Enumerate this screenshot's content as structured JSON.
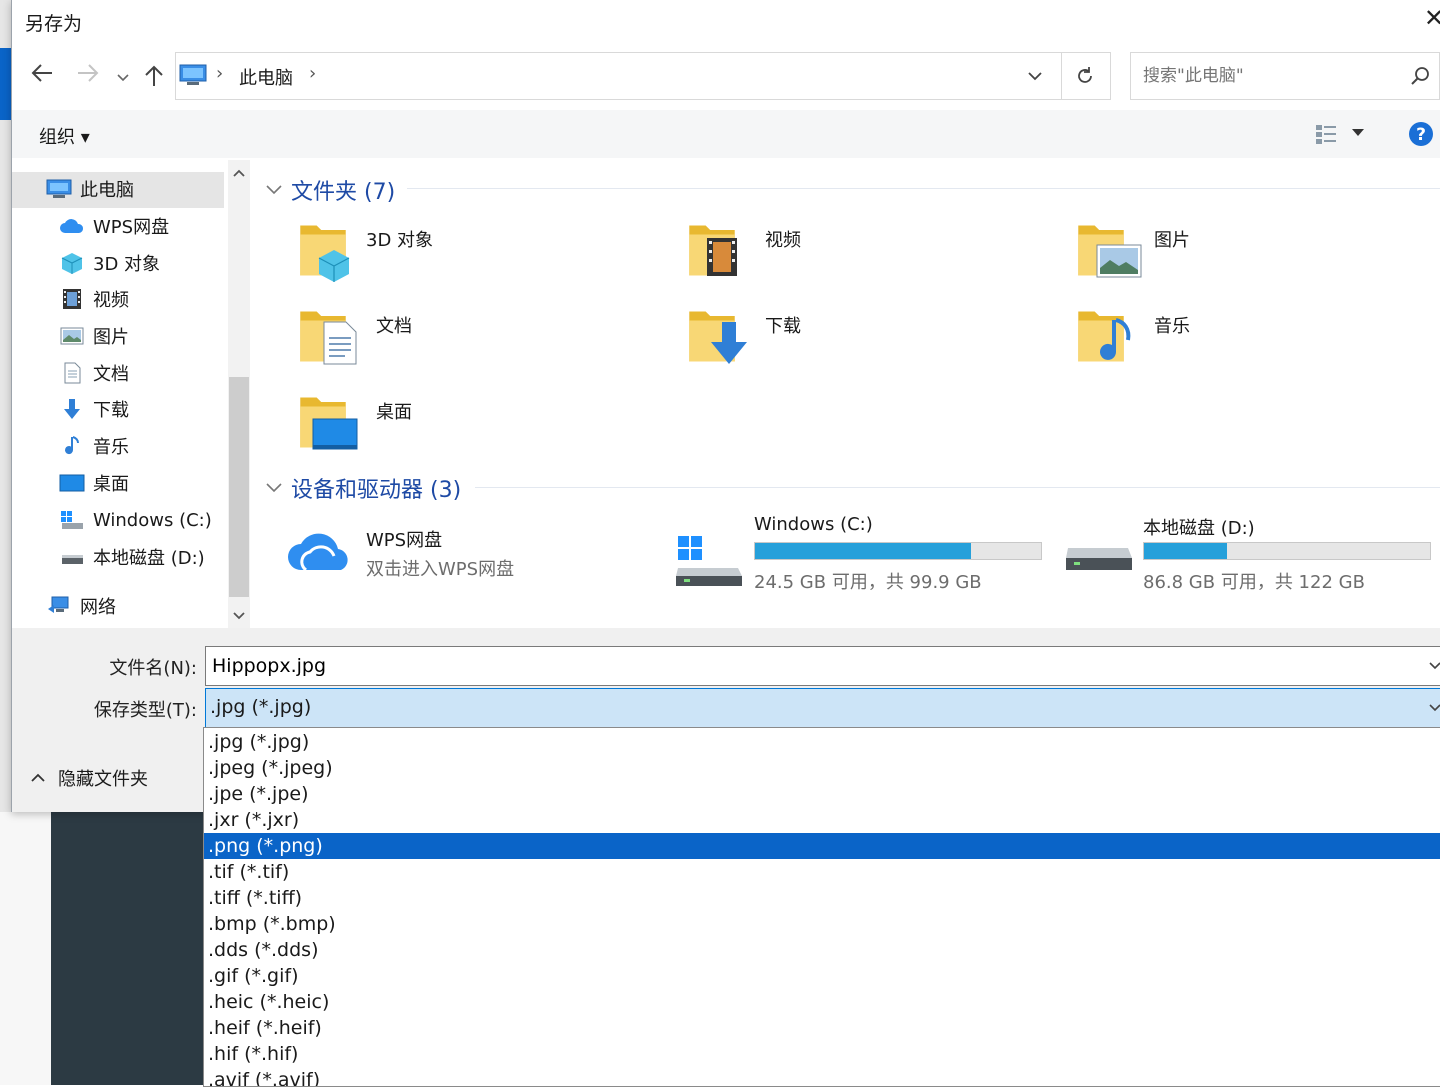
{
  "window": {
    "title": "另存为",
    "close_glyph": "✕"
  },
  "address": {
    "location": "此电脑",
    "separator": "›"
  },
  "search": {
    "placeholder": "搜索\"此电脑\""
  },
  "toolbar": {
    "organize": "组织 ▾"
  },
  "nav": {
    "items": [
      {
        "label": "此电脑",
        "icon": "computer-icon"
      },
      {
        "label": "WPS网盘",
        "icon": "cloud-icon"
      },
      {
        "label": "3D 对象",
        "icon": "cube-icon"
      },
      {
        "label": "视频",
        "icon": "video-icon"
      },
      {
        "label": "图片",
        "icon": "picture-icon"
      },
      {
        "label": "文档",
        "icon": "document-icon"
      },
      {
        "label": "下载",
        "icon": "download-icon"
      },
      {
        "label": "音乐",
        "icon": "music-icon"
      },
      {
        "label": "桌面",
        "icon": "desktop-icon"
      },
      {
        "label": "Windows (C:)",
        "icon": "windows-drive-icon"
      },
      {
        "label": "本地磁盘 (D:)",
        "icon": "drive-icon"
      },
      {
        "label": "网络",
        "icon": "network-icon"
      }
    ]
  },
  "content": {
    "folders_header": "文件夹 (7)",
    "folders": [
      {
        "label": "3D 对象",
        "icon": "cube-icon"
      },
      {
        "label": "视频",
        "icon": "video-icon"
      },
      {
        "label": "图片",
        "icon": "picture-icon"
      },
      {
        "label": "文档",
        "icon": "document-icon"
      },
      {
        "label": "下载",
        "icon": "download-icon"
      },
      {
        "label": "音乐",
        "icon": "music-icon"
      },
      {
        "label": "桌面",
        "icon": "desktop-icon"
      }
    ],
    "devices_header": "设备和驱动器 (3)",
    "devices": [
      {
        "label": "WPS网盘",
        "sub": "双击进入WPS网盘"
      },
      {
        "label": "Windows (C:)",
        "sub": "24.5 GB 可用，共 99.9 GB",
        "used_fraction": 0.755
      },
      {
        "label": "本地磁盘 (D:)",
        "sub": "86.8 GB 可用，共 122 GB",
        "used_fraction": 0.289
      }
    ]
  },
  "form": {
    "filename_label": "文件名(N):",
    "filename_value": "Hippopx.jpg",
    "filetype_label": "保存类型(T):",
    "filetype_value": ".jpg (*.jpg)",
    "hide_folders": "隐藏文件夹"
  },
  "filetype_options": [
    ".jpg (*.jpg)",
    ".jpeg (*.jpeg)",
    ".jpe (*.jpe)",
    ".jxr (*.jxr)",
    ".png (*.png)",
    ".tif (*.tif)",
    ".tiff (*.tiff)",
    ".bmp (*.bmp)",
    ".dds (*.dds)",
    ".gif (*.gif)",
    ".heic (*.heic)",
    ".heif (*.heif)",
    ".hif (*.hif)",
    ".avif (*.avif)"
  ],
  "highlighted_option": ".png (*.png)",
  "colors": {
    "accent": "#0a64c8",
    "header_blue": "#1e4aa5",
    "drive_bar": "#26a0da"
  }
}
